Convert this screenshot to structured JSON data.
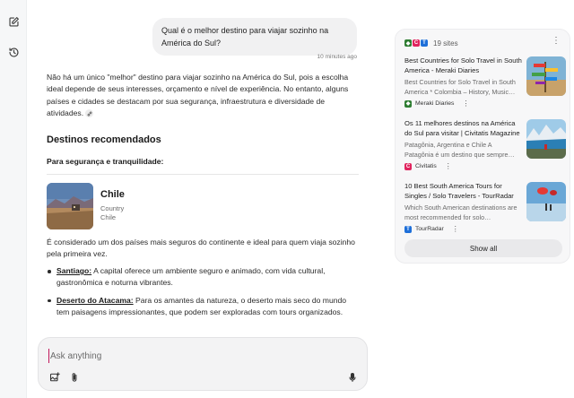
{
  "user_message": {
    "text": "Qual é o melhor destino para viajar sozinho na América do Sul?",
    "time": "10 minutes ago"
  },
  "answer": {
    "intro": "Não há um único \"melhor\" destino para viajar sozinho na América do Sul, pois a escolha ideal depende de seus interesses, orçamento e nível de experiência. No entanto, alguns países e cidades se destacam por sua segurança, infraestrutura e diversidade de atividades.",
    "heading": "Destinos recomendados",
    "subheading": "Para segurança e tranquilidade:",
    "place": {
      "name": "Chile",
      "type": "Country",
      "country": "Chile"
    },
    "place_text": "É considerado um dos países mais seguros do continente e ideal para quem viaja sozinho pela primeira vez.",
    "bullets": [
      {
        "title": "Santiago:",
        "text": " A capital oferece um ambiente seguro e animado, com vida cultural, gastronômica e noturna vibrantes."
      },
      {
        "title": "Deserto do Atacama:",
        "text": " Para os amantes da natureza, o deserto mais seco do mundo tem paisagens impressionantes, que podem ser exploradas com tours organizados."
      }
    ]
  },
  "composer": {
    "placeholder": "Ask anything"
  },
  "sources": {
    "count_label": "19 sites",
    "items": [
      {
        "title": "Best Countries for Solo Travel in South America - Meraki Diaries",
        "snippet": "Best Countries for Solo Travel in South America * Colombia – History, Music…",
        "site": "Meraki Diaries"
      },
      {
        "title": "Os 11 melhores destinos na América do Sul para visitar | Civitatis Magazine",
        "snippet": "Patagônia, Argentina e Chile A Patagônia é um destino que sempre…",
        "site": "Civitatis"
      },
      {
        "title": "10 Best South America Tours for Singles / Solo Travelers - TourRadar",
        "snippet": "Which South American destinations are most recommended for solo…",
        "site": "TourRadar"
      }
    ],
    "show_all": "Show all"
  },
  "colors": {
    "accent": "#c2185b",
    "civitatis": "#e0245e",
    "tourradar": "#1e6fd9",
    "meraki": "#2e7d32"
  },
  "icons": [
    "edit-icon",
    "history-icon",
    "image-upload-icon",
    "paperclip-icon",
    "microphone-icon"
  ]
}
